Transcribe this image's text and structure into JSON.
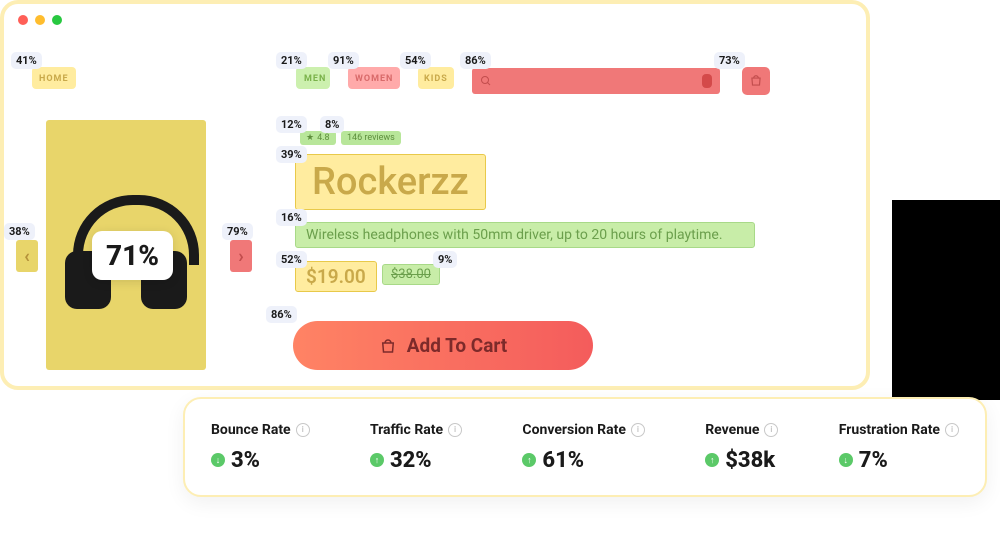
{
  "nav": {
    "home": "HOME",
    "men": "MEN",
    "women": "WOMEN",
    "kids": "KIDS"
  },
  "overlay": {
    "home": "41%",
    "men": "21%",
    "women": "91%",
    "kids": "54%",
    "search": "86%",
    "cart": "73%",
    "rating_box": "12%",
    "reviews": "8%",
    "title": "39%",
    "desc": "16%",
    "price": "52%",
    "oldprice": "9%",
    "atc": "86%",
    "img": "71%",
    "arrow_l": "38%",
    "arrow_r": "79%"
  },
  "product": {
    "rating": "4.8",
    "reviews": "146 reviews",
    "title": "Rockerzz",
    "desc": "Wireless headphones with 50mm driver, up to 20 hours of playtime.",
    "price": "$19.00",
    "old_price": "$38.00",
    "atc": "Add To Cart"
  },
  "stats": {
    "bounce": {
      "label": "Bounce Rate",
      "val": "3%",
      "dir": "down"
    },
    "traffic": {
      "label": "Traffic Rate",
      "val": "32%",
      "dir": "up"
    },
    "conversion": {
      "label": "Conversion Rate",
      "val": "61%",
      "dir": "up"
    },
    "revenue": {
      "label": "Revenue",
      "val": "$38k",
      "dir": "up"
    },
    "frustration": {
      "label": "Frustration Rate",
      "val": "7%",
      "dir": "down"
    }
  }
}
